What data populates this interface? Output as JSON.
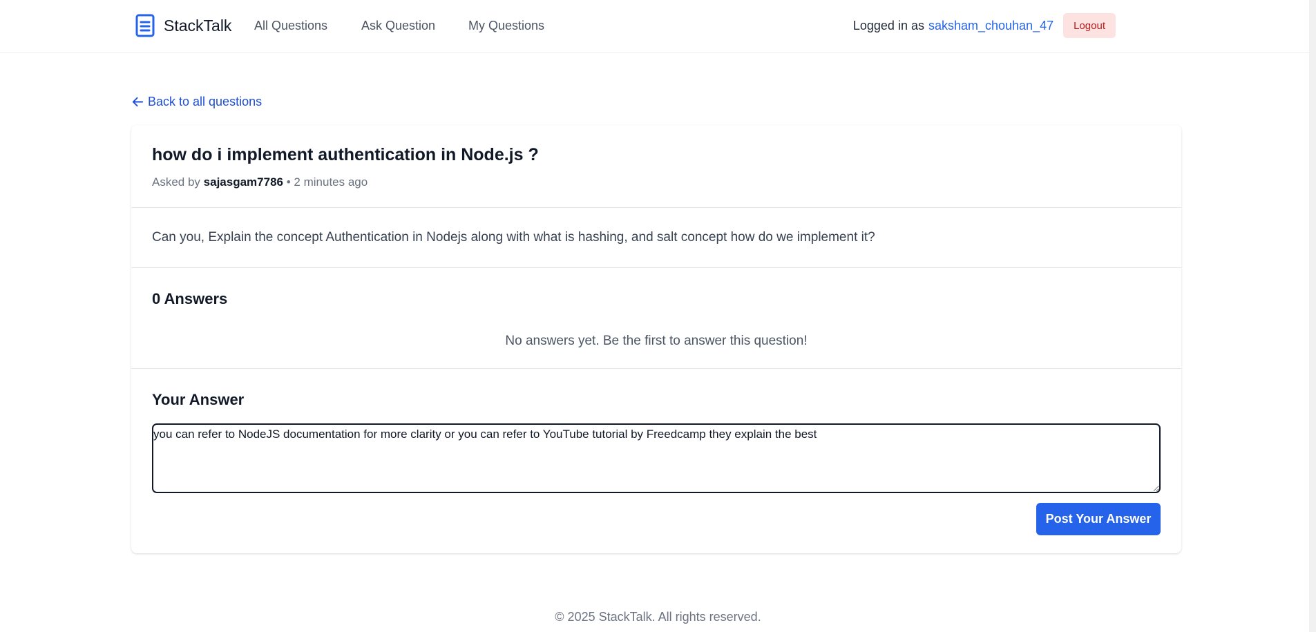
{
  "nav": {
    "brand": "StackTalk",
    "links": [
      "All Questions",
      "Ask Question",
      "My Questions"
    ],
    "logged_in_label": "Logged in as",
    "username": "saksham_chouhan_47",
    "logout_label": "Logout"
  },
  "back_link": "Back to all questions",
  "question": {
    "title": "how do i implement authentication in Node.js ?",
    "asked_by_label": "Asked by",
    "author": "sajasgam7786",
    "separator": "•",
    "time_ago": "2 minutes ago",
    "body": "Can you, Explain the concept Authentication in Nodejs along with what is hashing, and salt concept how do we implement it?"
  },
  "answers": {
    "heading": "0 Answers",
    "empty_message": "No answers yet. Be the first to answer this question!"
  },
  "answer_form": {
    "heading": "Your Answer",
    "value": "you can refer to NodeJS documentation for more clarity or you can refer to YouTube tutorial by Freedcamp they explain the best",
    "submit_label": "Post Your Answer"
  },
  "footer": "© 2025 StackTalk. All rights reserved.",
  "icons": {
    "brand": "document-icon",
    "back": "arrow-left-icon"
  },
  "colors": {
    "accent": "#2563eb",
    "logout_bg": "#fde2e2",
    "logout_text": "#b91c1c"
  }
}
